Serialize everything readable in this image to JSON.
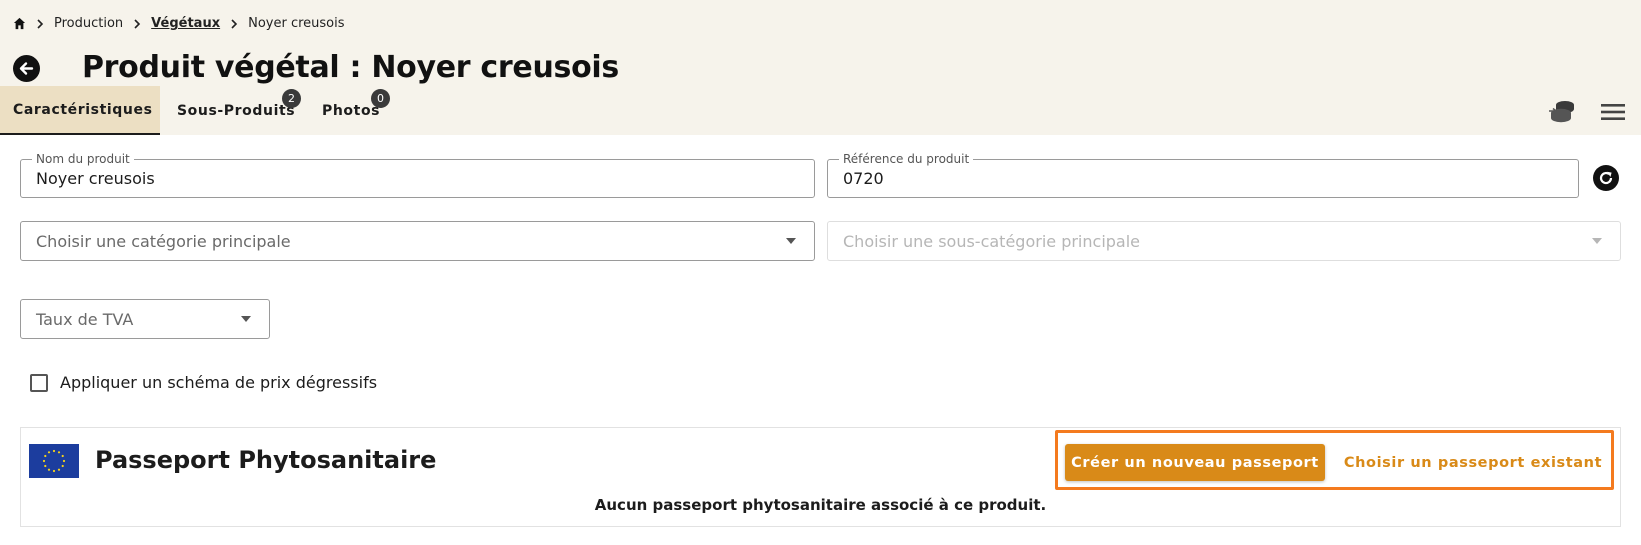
{
  "breadcrumb": {
    "items": [
      "Production",
      "Végétaux",
      "Noyer creusois"
    ]
  },
  "header": {
    "title": "Produit végétal : Noyer creusois"
  },
  "tabs": [
    {
      "label": "Caractéristiques",
      "active": true
    },
    {
      "label": "Sous-Produits",
      "badge": "2"
    },
    {
      "label": "Photos",
      "badge": "0"
    }
  ],
  "toolbar": {
    "icons": [
      "coins-icon",
      "menu-icon"
    ]
  },
  "form": {
    "product_name": {
      "label": "Nom du produit",
      "value": "Noyer creusois"
    },
    "product_ref": {
      "label": "Référence du produit",
      "value": "0720"
    },
    "main_category": {
      "placeholder": "Choisir une catégorie principale"
    },
    "sub_category": {
      "placeholder": "Choisir une sous-catégorie principale"
    },
    "vat": {
      "placeholder": "Taux de TVA"
    },
    "degressive_pricing": {
      "label": "Appliquer un schéma de prix dégressifs",
      "checked": false
    }
  },
  "passport": {
    "title": "Passeport Phytosanitaire",
    "create_label": "Créer un nouveau passeport",
    "choose_label": "Choisir un passeport existant",
    "empty_message": "Aucun passeport phytosanitaire associé à ce produit."
  },
  "colors": {
    "header_bg": "#f6f3eb",
    "active_tab_bg": "#ecdfc3",
    "accent": "#d98a18",
    "highlight": "#f47a1e",
    "eu_blue": "#1c3d9e"
  }
}
